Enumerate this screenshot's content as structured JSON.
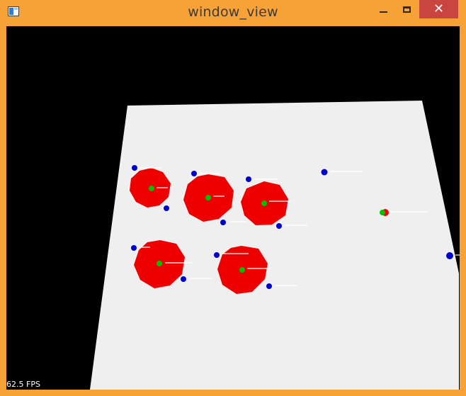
{
  "window": {
    "title": "window_view",
    "controls": {
      "minimize": "minimize",
      "maximize": "maximize",
      "close": "✕"
    }
  },
  "scene": {
    "fps_label": "62.5 FPS",
    "colors": {
      "background": "#000000",
      "ground": "#efefef",
      "obstacle": "#ee0000",
      "robot": "#00c000",
      "item": "#0000cc",
      "label": "#ffffff"
    }
  }
}
